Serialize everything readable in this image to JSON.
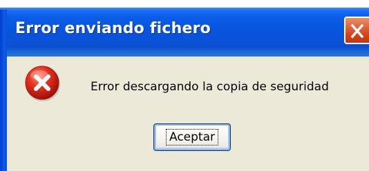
{
  "window": {
    "title": "Error enviando fichero",
    "close_icon": "close-icon"
  },
  "message": {
    "icon": "error-icon",
    "text": "Error descargando la copia de seguridad"
  },
  "buttons": {
    "ok_label": "Aceptar"
  },
  "colors": {
    "titlebar": "#0a52d8",
    "dialog_background": "#ece9d8",
    "close_button": "#d0431a",
    "error_icon": "#d8231d"
  }
}
